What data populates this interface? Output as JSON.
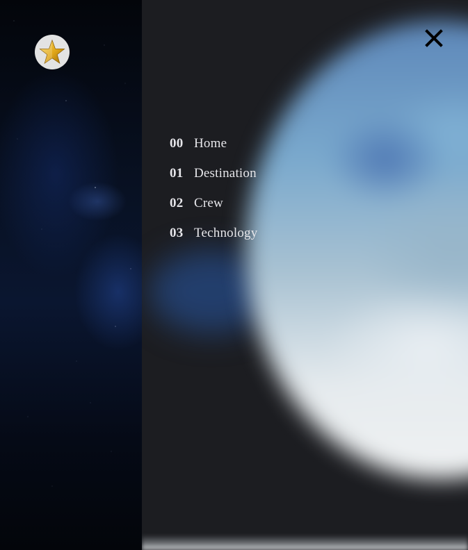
{
  "brand": {
    "logo_icon": "star-icon",
    "logo_bg": "#e3e3e3",
    "star_color": "#e0a618"
  },
  "menu": {
    "close_icon": "close-icon",
    "items": [
      {
        "number": "00",
        "label": "Home"
      },
      {
        "number": "01",
        "label": "Destination"
      },
      {
        "number": "02",
        "label": "Crew"
      },
      {
        "number": "03",
        "label": "Technology"
      }
    ]
  },
  "colors": {
    "panel_bg": "#1c1d21",
    "nav_text": "#e6e6ea",
    "close_icon": "#000000"
  }
}
